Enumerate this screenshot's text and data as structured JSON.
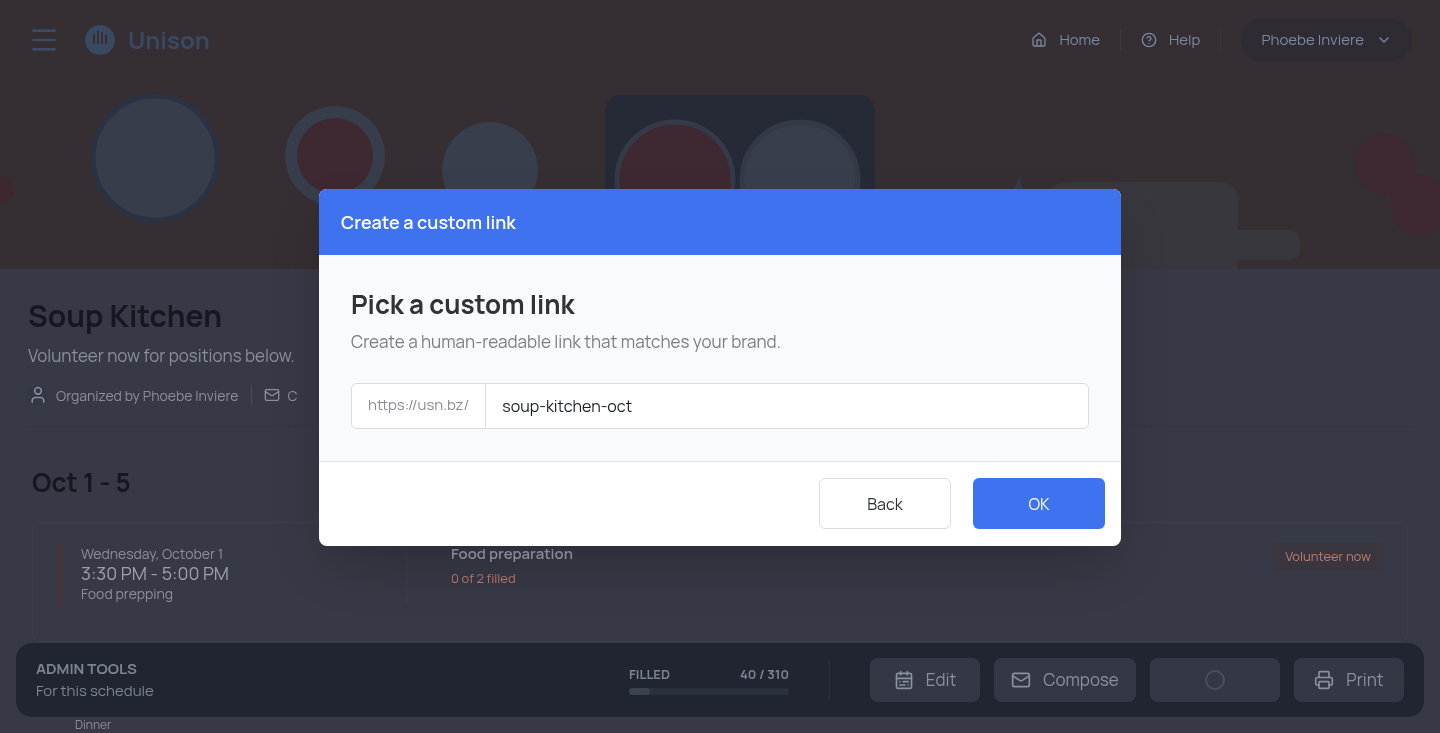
{
  "header": {
    "brand": "Unison",
    "nav": [
      {
        "label": "Home"
      },
      {
        "label": "Help"
      }
    ],
    "user": "Phoebe Inviere"
  },
  "event": {
    "title": "Soup Kitchen",
    "subtitle": "Volunteer now for positions below.",
    "organizer": "Organized by Phoebe Inviere",
    "contact": "C"
  },
  "schedule": {
    "range": "Oct 1 - 5",
    "slots": [
      {
        "date": "Wednesday, October 1",
        "time": "3:30 PM - 5:00 PM",
        "note": "Food prepping",
        "position": "Food preparation",
        "filled": "0 of 2 filled",
        "action": "Volunteer now"
      }
    ],
    "next_note": "Dinner"
  },
  "admin": {
    "title": "ADMIN TOOLS",
    "subtitle": "For this schedule",
    "filled_label": "FILLED",
    "filled_count": "40 / 310",
    "level": 0.13,
    "buttons": [
      {
        "kind": "edit",
        "label": "Edit"
      },
      {
        "kind": "compose",
        "label": "Compose"
      },
      {
        "kind": "loading"
      },
      {
        "kind": "print",
        "label": "Print"
      }
    ]
  },
  "dialog": {
    "title": "Create a custom link",
    "heading": "Pick a custom link",
    "description": "Create a human-readable link that matches your brand.",
    "prefix": "https://usn.bz/",
    "value": "soup-kitchen-oct",
    "buttons": [
      {
        "label": "Back",
        "primary": false
      },
      {
        "label": "OK",
        "primary": true
      }
    ]
  }
}
